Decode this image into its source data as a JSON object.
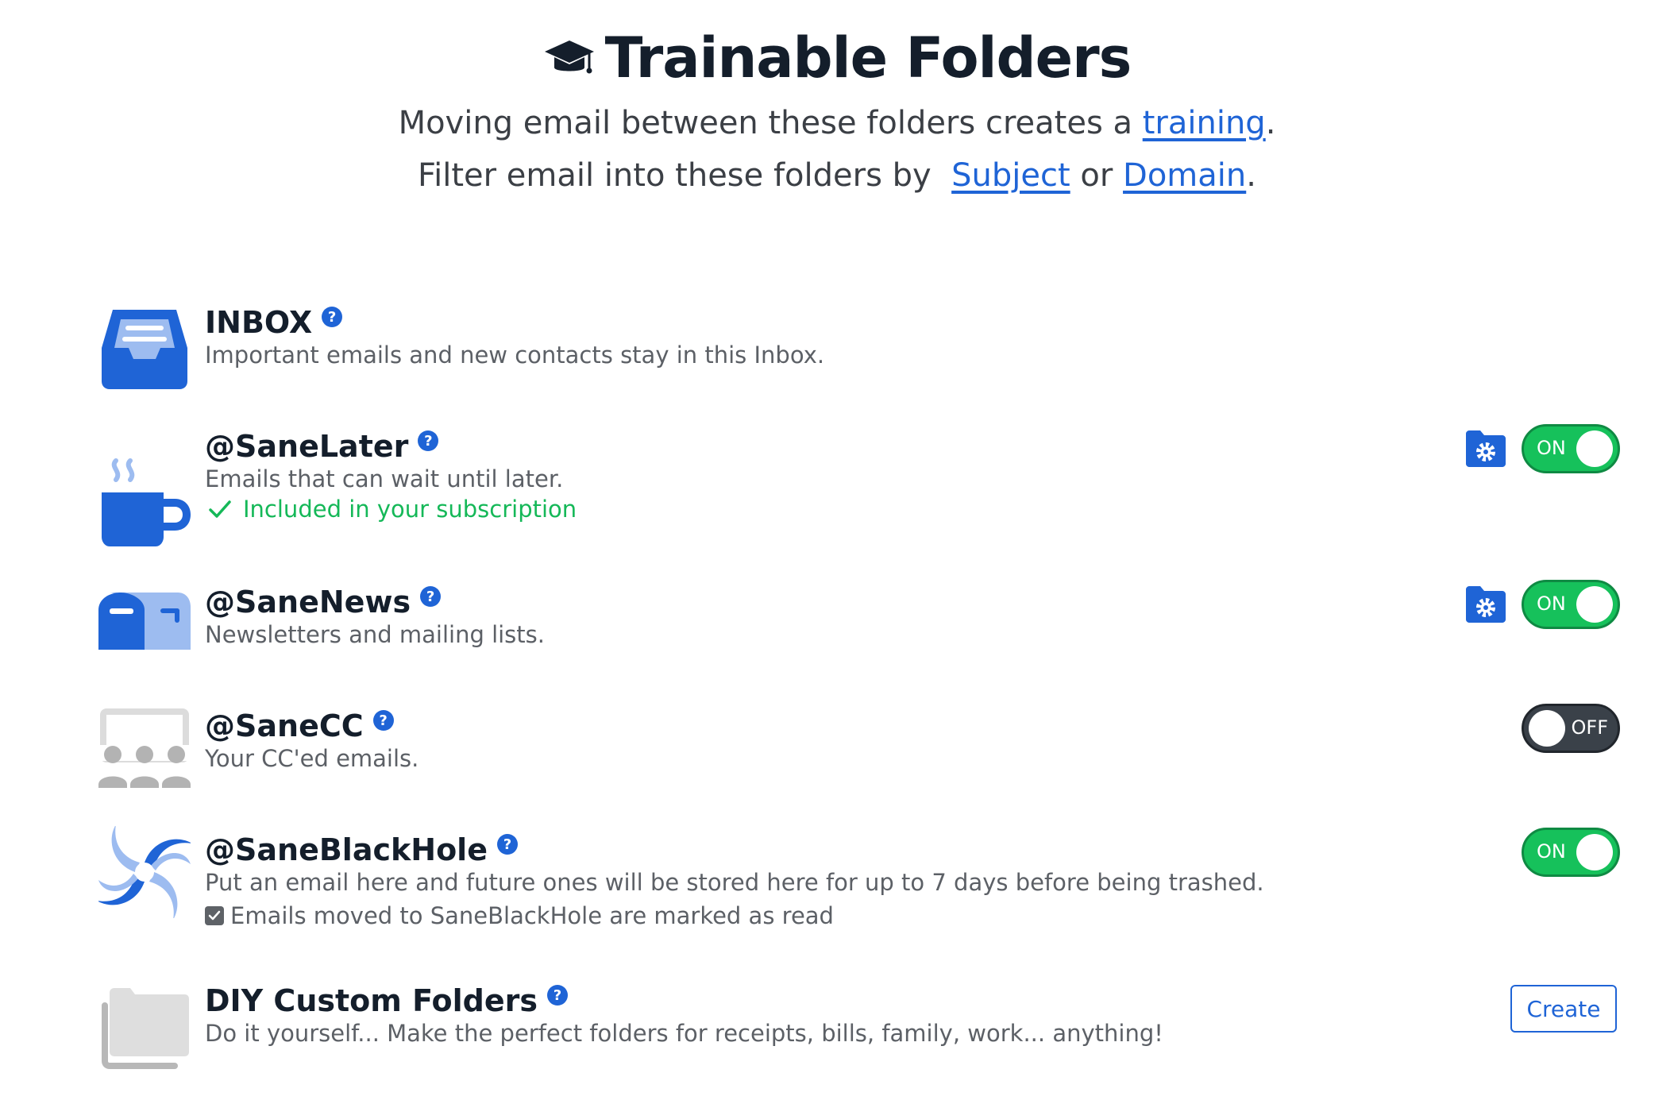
{
  "header": {
    "title": "Trainable Folders",
    "line1_text": "Moving email between these folders creates a",
    "line1_link": "training",
    "line2_text": "Filter email into these folders by",
    "line2_link1": "Subject",
    "line2_or": "or",
    "line2_link2": "Domain",
    "period": "."
  },
  "folders": [
    {
      "name": "INBOX",
      "help": "?",
      "desc": "Important emails and new contacts stay in this Inbox.",
      "icon": "inbox-tray-icon"
    },
    {
      "name": "@SaneLater",
      "help": "?",
      "desc": "Emails that can wait until later.",
      "note": "Included in your subscription",
      "toggle": "ON",
      "icon": "coffee-cup-icon"
    },
    {
      "name": "@SaneNews",
      "help": "?",
      "desc": "Newsletters and mailing lists.",
      "toggle": "ON",
      "icon": "mailbox-icon"
    },
    {
      "name": "@SaneCC",
      "help": "?",
      "desc": "Your CC'ed emails.",
      "toggle": "OFF",
      "icon": "audience-icon"
    },
    {
      "name": "@SaneBlackHole",
      "help": "?",
      "desc": "Put an email here and future ones will be stored here for up to 7 days before being trashed.",
      "checkbox_label": "Emails moved to SaneBlackHole are marked as read",
      "checkbox_checked": true,
      "toggle": "ON",
      "icon": "black-hole-swirl-icon"
    },
    {
      "name": "DIY Custom Folders",
      "help": "?",
      "desc": "Do it yourself... Make the perfect folders for receipts, bills, family, work... anything!",
      "button": "Create",
      "icon": "folders-icon"
    }
  ],
  "colors": {
    "accent": "#1f64d6",
    "on": "#16c15b",
    "off": "#3a4149",
    "included": "#15b858"
  }
}
